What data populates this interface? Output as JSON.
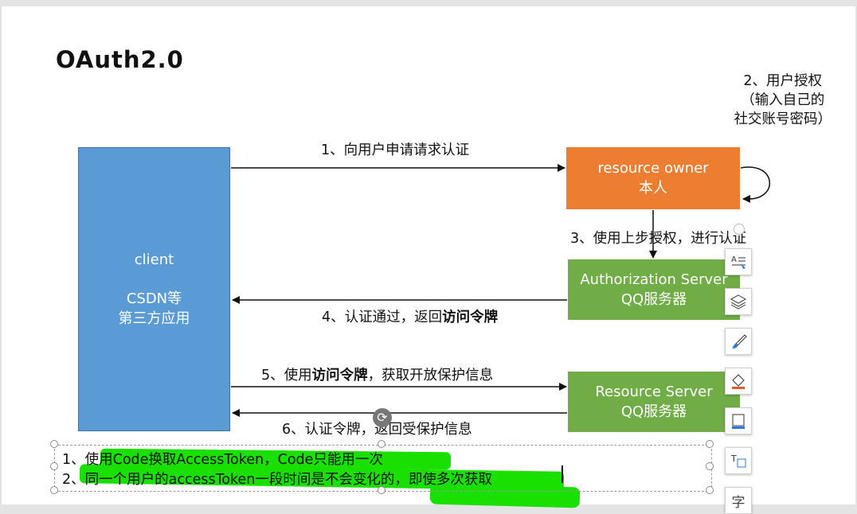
{
  "slide": {
    "title": "OAuth2.0"
  },
  "diagram": {
    "client": {
      "line1": "client",
      "line2": "CSDN等",
      "line3": "第三方应用"
    },
    "resource_owner": {
      "line1": "resource owner",
      "line2": "本人"
    },
    "authorization_server": {
      "line1": "Authorization Server",
      "line2": "QQ服务器"
    },
    "resource_server": {
      "line1": "Resource Server",
      "line2": "QQ服务器"
    },
    "owner_note": {
      "line1": "2、用户授权",
      "line2": "（输入自己的",
      "line3": "社交账号密码）"
    },
    "steps": {
      "step1": "1、向用户申请请求认证",
      "step3": "3、使用上步授权，进行认证",
      "step4_prefix": "4、认证通过，返回",
      "step4_bold": "访问令牌",
      "step5_prefix": "5、使用",
      "step5_bold": "访问令牌",
      "step5_suffix": "，获取开放保护信息",
      "step6": "6、认证令牌，返回受保护信息"
    }
  },
  "textbox": {
    "line1": "1、使用Code换取AccessToken，Code只能用一次",
    "line2": "2、同一个用户的accessToken一段时间是不会变化的，即使多次获取"
  },
  "toolbar": {
    "icons": [
      "text-style-icon",
      "layers-icon",
      "brush-icon",
      "fill-icon",
      "border-icon",
      "text-frame-icon",
      "font-icon"
    ],
    "font_button_label": "字"
  },
  "colors": {
    "client": "#5b9bd5",
    "resource_owner": "#ed7d31",
    "servers": "#70ad47",
    "highlight": "#19e000"
  }
}
